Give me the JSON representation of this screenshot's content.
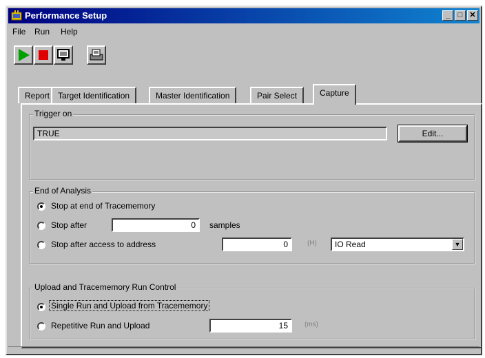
{
  "window": {
    "title": "Performance Setup",
    "minimize": "_",
    "maximize": "□",
    "close": "✕"
  },
  "menu": {
    "file": "File",
    "run": "Run",
    "help": "Help"
  },
  "tabs": [
    "Report",
    "Target Identification",
    "Master Identification",
    "Pair Select",
    "Capture"
  ],
  "active_tab": "Capture",
  "trigger": {
    "group_label": "Trigger on",
    "value": "TRUE",
    "edit_button": "Edit..."
  },
  "end_of_analysis": {
    "group_label": "End of Analysis",
    "opt1": "Stop at end of Tracememory",
    "opt2": "Stop after",
    "opt2_value": "0",
    "opt2_unit": "samples",
    "opt3": "Stop after access to address",
    "opt3_value": "0",
    "opt3_unit": "(H)",
    "opt3_select": "IO Read",
    "selected": 1
  },
  "upload": {
    "group_label": "Upload and Tracememory Run Control",
    "opt1": "Single Run and Upload from Tracememory",
    "opt2": "Repetitive Run and Upload",
    "opt2_value": "15",
    "opt2_unit": "(ms)",
    "selected": 1
  },
  "colors": {
    "titlebar": "#000080",
    "face": "#c0c0c0",
    "play": "#00a000",
    "stop": "#e00000"
  }
}
